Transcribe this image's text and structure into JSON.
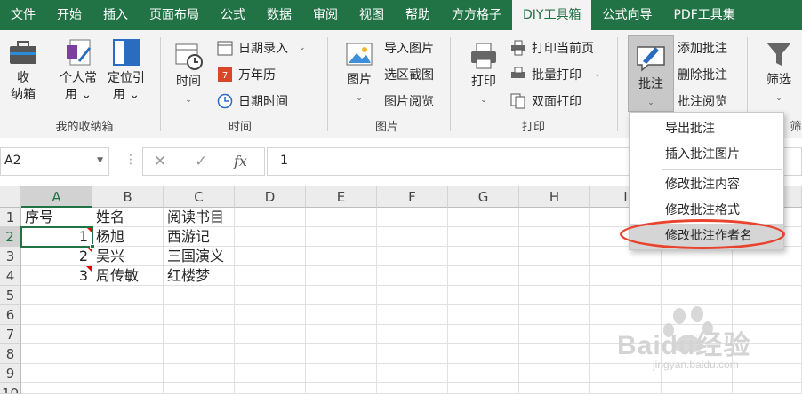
{
  "tabs": [
    "文件",
    "开始",
    "插入",
    "页面布局",
    "公式",
    "数据",
    "审阅",
    "视图",
    "帮助",
    "方方格子",
    "DIY工具箱",
    "公式向导",
    "PDF工具集"
  ],
  "active_tab": "DIY工具箱",
  "ribbon": {
    "g1": {
      "b1": "收\n纳箱",
      "b2": "个人常\n用 ⌄",
      "b3": "定位引\n用 ⌄",
      "label": "我的收纳箱"
    },
    "g2": {
      "time": "时间",
      "date_entry": "日期录入",
      "wannianli": "万年历",
      "date_time": "日期时间",
      "label": "时间"
    },
    "g3": {
      "picture": "图片",
      "import": "导入图片",
      "region": "选区截图",
      "browse": "图片阅览",
      "label": "图片"
    },
    "g4": {
      "print": "打印",
      "print_current": "打印当前页",
      "batch_print": "批量打印",
      "duplex": "双面打印",
      "label": "打印"
    },
    "g5": {
      "comment": "批注",
      "add": "添加批注",
      "delete": "删除批注",
      "browse": "批注阅览",
      "filter": "筛选",
      "label_partial": "筛"
    }
  },
  "formula_bar": {
    "name_box": "A2",
    "fx": "fx",
    "value": "1"
  },
  "columns": [
    "A",
    "B",
    "C",
    "D",
    "E",
    "F",
    "G",
    "H",
    "I"
  ],
  "rows": [
    "1",
    "2",
    "3",
    "4",
    "5",
    "6",
    "7",
    "8",
    "9",
    "10"
  ],
  "cells": [
    [
      "序号",
      "姓名",
      "阅读书目"
    ],
    [
      "1",
      "杨旭",
      "西游记"
    ],
    [
      "2",
      "吴兴",
      "三国演义"
    ],
    [
      "3",
      "周传敏",
      "红楼梦"
    ]
  ],
  "menu": [
    "导出批注",
    "插入批注图片",
    "修改批注内容",
    "修改批注格式",
    "修改批注作者名"
  ],
  "watermark": {
    "brand": "Baidu经验",
    "url": "jingyan.baidu.com"
  },
  "colors": {
    "excel_green": "#217346",
    "highlight_oval": "#e8432e",
    "comment_marker": "#e00000"
  }
}
